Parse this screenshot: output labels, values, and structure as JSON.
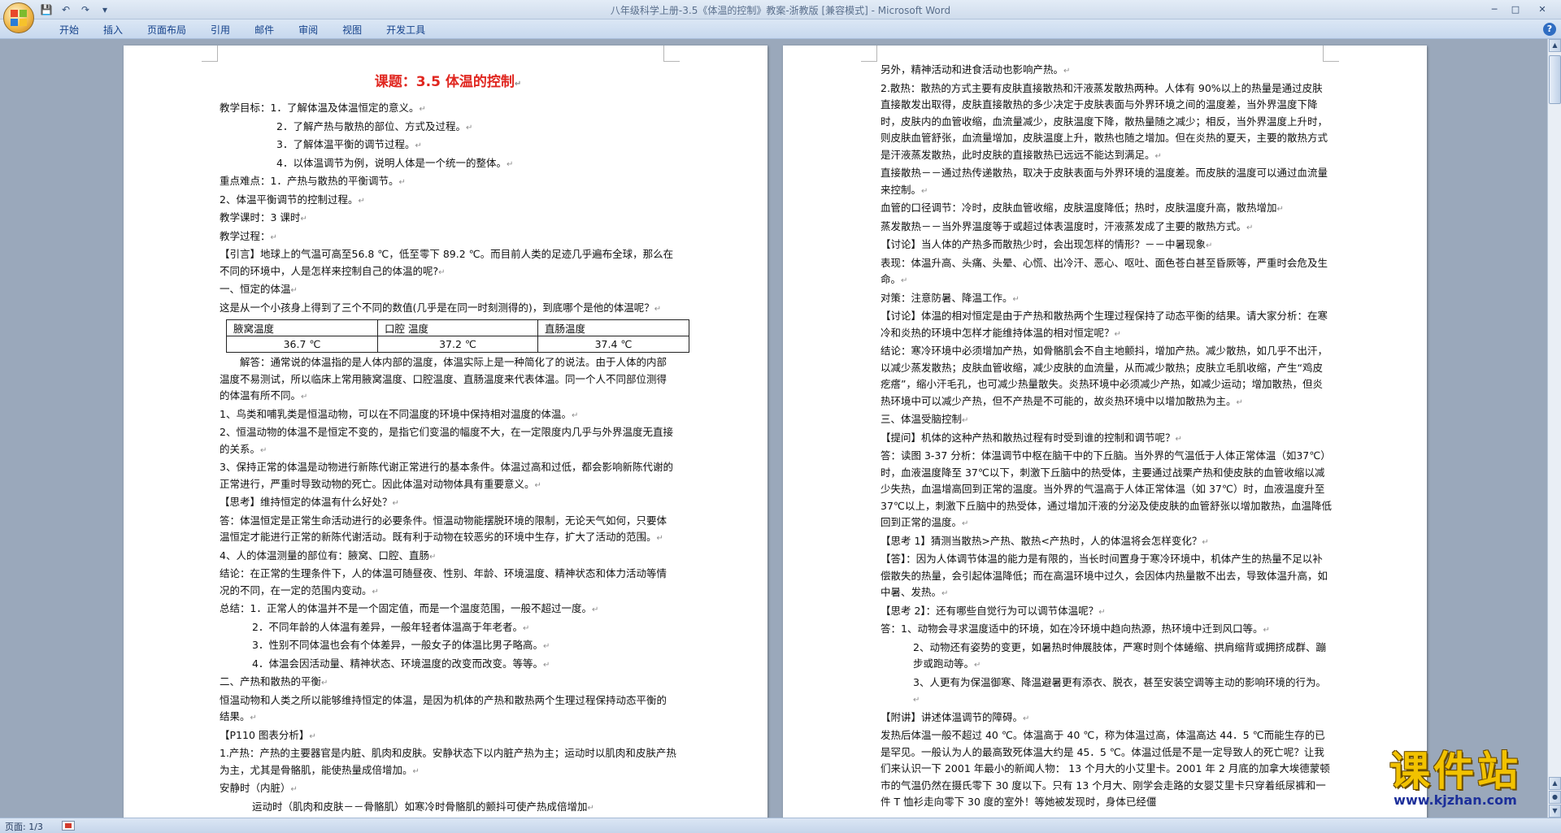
{
  "window": {
    "title": "八年级科学上册-3.5《体温的控制》教案-浙教版 [兼容模式] - Microsoft Word"
  },
  "ribbon": {
    "tabs": [
      "开始",
      "插入",
      "页面布局",
      "引用",
      "邮件",
      "审阅",
      "视图",
      "开发工具"
    ]
  },
  "status": {
    "page": "页面: 1/3"
  },
  "watermark": {
    "logo": "课件站",
    "url": "www.kjzhan.com"
  },
  "doc": {
    "title": "课题：3.5 体温的控制",
    "left": {
      "goals": [
        "教学目标：1．了解体温及体温恒定的意义。",
        "2．了解产热与散热的部位、方式及过程。",
        "3．了解体温平衡的调节过程。",
        "4．以体温调节为例，说明人体是一个统一的整体。"
      ],
      "key_points": [
        "重点难点：1．产热与散热的平衡调节。",
        "2、体温平衡调节的控制过程。"
      ],
      "hours": "教学课时：3 课时",
      "process": "教学过程：",
      "intro": "【引言】地球上的气温可高至56.8 ℃，低至零下 89.2 ℃。而目前人类的足迹几乎遍布全球，那么在不同的环境中，人是怎样来控制自己的体温的呢?",
      "section1": "一、恒定的体温",
      "question": "这是从一个小孩身上得到了三个不同的数值(几乎是在同一时刻测得的)，到底哪个是他的体温呢？",
      "table": {
        "headers": [
          "腋窝温度",
          "口腔 温度",
          "直肠温度"
        ],
        "values": [
          "36.7 ℃",
          "37.2 ℃",
          "37.4 ℃"
        ]
      },
      "answer": "解答：通常说的体温指的是人体内部的温度，体温实际上是一种简化了的说法。由于人体的内部温度不易测试，所以临床上常用腋窝温度、口腔温度、直肠温度来代表体温。同一个人不同部位测得的体温有所不同。",
      "p1": "1、鸟类和哺乳类是恒温动物，可以在不同温度的环境中保持相对温度的体温。",
      "p2": "2、恒温动物的体温不是恒定不变的，是指它们变温的幅度不大，在一定限度内几乎与外界温度无直接的关系。",
      "p3": "3、保持正常的体温是动物进行新陈代谢正常进行的基本条件。体温过高和过低，都会影响新陈代谢的正常进行，严重时导致动物的死亡。因此体温对动物体具有重要意义。",
      "think1": "【思考】维持恒定的体温有什么好处？",
      "answer2": "答：体温恒定是正常生命活动进行的必要条件。恒温动物能摆脱环境的限制，无论天气如何，只要体温恒定才能进行正常的新陈代谢活动。既有利于动物在较恶劣的环境中生存，扩大了活动的范围。",
      "p4": "4、人的体温测量的部位有：腋窝、口腔、直肠",
      "conclusion": "结论：在正常的生理条件下，人的体温可随昼夜、性别、年龄、环境温度、精神状态和体力活动等情况的不同，在一定的范围内变动。",
      "summary": [
        "总结：1．正常人的体温并不是一个固定值，而是一个温度范围，一般不超过一度。",
        "2．不同年龄的人体温有差异，一般年轻者体温高于年老者。",
        "3．性别不同体温也会有个体差异，一般女子的体温比男子略高。",
        "4．体温会因活动量、精神状态、环境温度的改变而改变。等等。"
      ],
      "section2": "二、产热和散热的平衡",
      "balance": "恒温动物和人类之所以能够维持恒定的体温，是因为机体的产热和散热两个生理过程保持动态平衡的结果。",
      "p110": "【P110 图表分析】",
      "heat1": "1.产热：产热的主要器官是内脏、肌肉和皮肤。安静状态下以内脏产热为主；运动时以肌肉和皮肤产热为主，尤其是骨骼肌，能使热量成倍增加。",
      "rest": "安静时（内脏）",
      "exercise": "运动时（肌肉和皮肤－－骨骼肌）如寒冷时骨骼肌的颤抖可使产热成倍增加"
    },
    "right": {
      "r0": "另外，精神活动和进食活动也影响产热。",
      "r1": "2.散热：散热的方式主要有皮肤直接散热和汗液蒸发散热两种。人体有 90%以上的热量是通过皮肤直接散发出取得，皮肤直接散热的多少决定于皮肤表面与外界环境之间的温度差，当外界温度下降时，皮肤内的血管收缩，血流量减少，皮肤温度下降，散热量随之减少；相反，当外界温度上升时，则皮肤血管舒张，血流量增加，皮肤温度上升，散热也随之增加。但在炎热的夏天，主要的散热方式是汗液蒸发散热，此时皮肤的直接散热已远远不能达到满足。",
      "r2": "直接散热－－通过热传递散热，取决于皮肤表面与外界环境的温度差。而皮肤的温度可以通过血流量来控制。",
      "r3": "血管的口径调节：冷时，皮肤血管收缩，皮肤温度降低；热时，皮肤温度升高，散热增加",
      "r4": "蒸发散热－－当外界温度等于或超过体表温度时，汗液蒸发成了主要的散热方式。",
      "r5": "【讨论】当人体的产热多而散热少时，会出现怎样的情形？－－中暑现象",
      "r6": "表现：体温升高、头痛、头晕、心慌、出冷汗、恶心、呕吐、面色苍白甚至昏厥等，严重时会危及生命。",
      "r7": "对策：注意防暑、降温工作。",
      "r8": "【讨论】体温的相对恒定是由于产热和散热两个生理过程保持了动态平衡的结果。请大家分析：在寒冷和炎热的环境中怎样才能维持体温的相对恒定呢？",
      "r9": "结论：寒冷环境中必须增加产热，如骨骼肌会不自主地颤抖，增加产热。减少散热，如几乎不出汗，以减少蒸发散热；皮肤血管收缩，减少皮肤的血流量，从而减少散热；皮肤立毛肌收缩，产生“鸡皮疙瘩”，缩小汗毛孔，也可减少热量散失。炎热环境中必须减少产热，如减少运动；增加散热，但炎热环境中可以减少产热，但不产热是不可能的，故炎热环境中以增加散热为主。",
      "r10": "三、体温受脑控制",
      "r11": "【提问】机体的这种产热和散热过程有时受到谁的控制和调节呢？",
      "r12": "答：读图 3-37 分析：体温调节中枢在脑干中的下丘脑。当外界的气温低于人体正常体温（如37℃）时，血液温度降至 37℃以下，刺激下丘脑中的热受体，主要通过战栗产热和使皮肤的血管收缩以减少失热，血温增高回到正常的温度。当外界的气温高于人体正常体温（如 37℃）时，血液温度升至 37℃以上，刺激下丘脑中的热受体，通过增加汗液的分泌及使皮肤的血管舒张以增加散热，血温降低回到正常的温度。",
      "r13": "【思考 1】猜测当散热>产热、散热<产热时，人的体温将会怎样变化？",
      "r14": "【答】：因为人体调节体温的能力是有限的，当长时间置身于寒冷环境中，机体产生的热量不足以补偿散失的热量，会引起体温降低；而在高温环境中过久，会因体内热量散不出去，导致体温升高，如中暑、发热。",
      "r15": "【思考 2】：还有哪些自觉行为可以调节体温呢？",
      "r16": "答：1、动物会寻求温度适中的环境，如在冷环境中趋向热源，热环境中迁到风口等。",
      "r17": "2、动物还有姿势的变更，如暑热时伸展肢体，严寒时则个体蜷缩、拱肩缩背或拥挤成群、蹦步或跑动等。",
      "r18": "3、人更有为保温御寒、降温避暑更有添衣、脱衣，甚至安装空调等主动的影响环境的行为。",
      "r19": "【附讲】讲述体温调节的障碍。",
      "r20": "发热后体温一般不超过 40 ℃。体温高于 40 ℃，称为体温过高，体温高达 44．5 ℃而能生存的已是罕见。一般认为人的最高致死体温大约是 45．5 ℃。体温过低是不是一定导致人的死亡呢？让我们来认识一下 2001 年最小的新闻人物： 13 个月大的小艾里卡。2001 年 2 月底的加拿大埃德蒙顿市的气温仍然在摄氏零下 30 度以下。只有 13 个月大、刚学会走路的女婴艾里卡只穿着纸尿裤和一件 T 恤衫走向零下 30 度的室外！等她被发现时，身体已经僵"
    }
  }
}
